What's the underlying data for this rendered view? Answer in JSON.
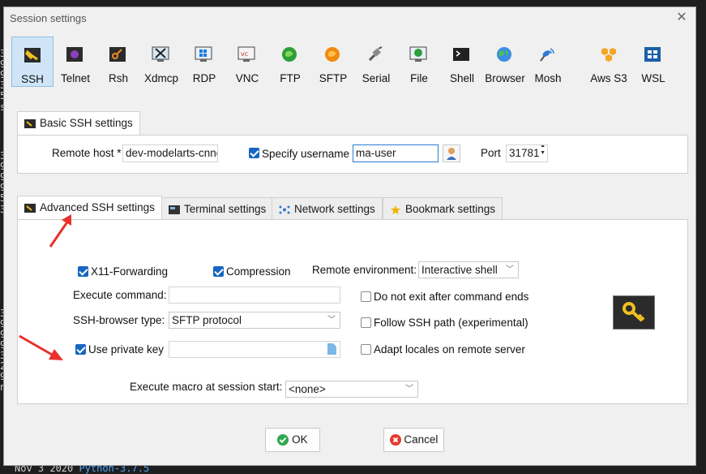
{
  "background": {
    "term_chars": [
      "30",
      "96",
      "96",
      "30",
      "55",
      "sh",
      "30",
      "96",
      "96",
      "96",
      "55",
      "32",
      "30",
      "96",
      "96",
      "96",
      "32",
      "20",
      "95",
      "nn"
    ],
    "term_bottom_date": "Nov  3  2020",
    "term_bottom_python": "Python-3.7.5"
  },
  "window": {
    "title": "Session settings",
    "close_glyph": "✕"
  },
  "session_types": [
    {
      "label": "SSH",
      "icon": "ssh-icon",
      "selected": true
    },
    {
      "label": "Telnet",
      "icon": "telnet-icon"
    },
    {
      "label": "Rsh",
      "icon": "rsh-icon"
    },
    {
      "label": "Xdmcp",
      "icon": "xdmcp-icon"
    },
    {
      "label": "RDP",
      "icon": "rdp-icon"
    },
    {
      "label": "VNC",
      "icon": "vnc-icon"
    },
    {
      "label": "FTP",
      "icon": "ftp-icon"
    },
    {
      "label": "SFTP",
      "icon": "sftp-icon"
    },
    {
      "label": "Serial",
      "icon": "serial-icon"
    },
    {
      "label": "File",
      "icon": "file-icon"
    },
    {
      "label": "Shell",
      "icon": "shell-icon"
    },
    {
      "label": "Browser",
      "icon": "browser-icon"
    },
    {
      "label": "Mosh",
      "icon": "mosh-icon"
    },
    {
      "label": "Aws S3",
      "icon": "aws-s3-icon"
    },
    {
      "label": "WSL",
      "icon": "wsl-icon"
    }
  ],
  "basic": {
    "tab_label": "Basic SSH settings",
    "remote_host_label": "Remote host *",
    "remote_host_value": "dev-modelarts-cnnc",
    "specify_username_label": "Specify username",
    "specify_username_checked": true,
    "username_value": "ma-user",
    "port_label": "Port",
    "port_value": "31781"
  },
  "tabs": [
    {
      "label": "Advanced SSH settings",
      "icon": "wrench-icon",
      "active": true
    },
    {
      "label": "Terminal settings",
      "icon": "terminal-icon"
    },
    {
      "label": "Network settings",
      "icon": "network-icon"
    },
    {
      "label": "Bookmark settings",
      "icon": "star-icon"
    }
  ],
  "advanced": {
    "x11_label": "X11-Forwarding",
    "x11_checked": true,
    "compression_label": "Compression",
    "compression_checked": true,
    "remote_env_label": "Remote environment:",
    "remote_env_value": "Interactive shell",
    "exec_cmd_label": "Execute command:",
    "exec_cmd_value": "",
    "no_exit_label": "Do not exit after command ends",
    "no_exit_checked": false,
    "browser_type_label": "SSH-browser type:",
    "browser_type_value": "SFTP protocol",
    "follow_path_label": "Follow SSH path (experimental)",
    "follow_path_checked": false,
    "private_key_label": "Use private key",
    "private_key_checked": true,
    "private_key_value": "",
    "adapt_locales_label": "Adapt locales on remote server",
    "adapt_locales_checked": false,
    "macro_label": "Execute macro at session start:",
    "macro_value": "<none>"
  },
  "buttons": {
    "ok": "OK",
    "cancel": "Cancel"
  },
  "colors": {
    "accent": "#1766c2",
    "selected_bg": "#cfe5f7",
    "arrow": "#e8312a",
    "ok": "#2fa84f",
    "cancel": "#e33b2f"
  }
}
